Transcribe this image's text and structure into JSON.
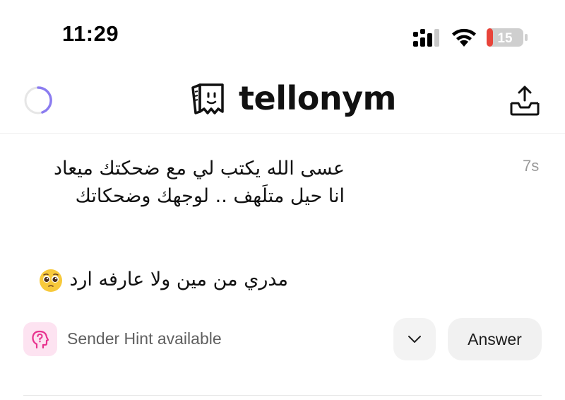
{
  "status_bar": {
    "time": "11:29",
    "battery_level": "15",
    "battery_color": "#e8443a"
  },
  "header": {
    "app_name": "tellonym",
    "left_icon": "loading-spinner-icon",
    "logo_icon": "tellonym-logo-icon",
    "right_icon": "share-tray-icon",
    "spinner_color": "#8b7cf0"
  },
  "tell": {
    "message_lines": "عسى الله يكتب لي مع ضحكتك ميعاد\nانا حيل متلَهف .. لوجهك وضحكاتك",
    "message_second": "مدري من مين ولا عارفه ارد",
    "emoji_icon": "pleading-face-emoji-icon",
    "time_ago": "7s"
  },
  "actions": {
    "hint_icon": "head-question-icon",
    "hint_text": "Sender Hint available",
    "hint_color": "#e8338f",
    "expand_icon": "chevron-down-icon",
    "answer_label": "Answer"
  }
}
